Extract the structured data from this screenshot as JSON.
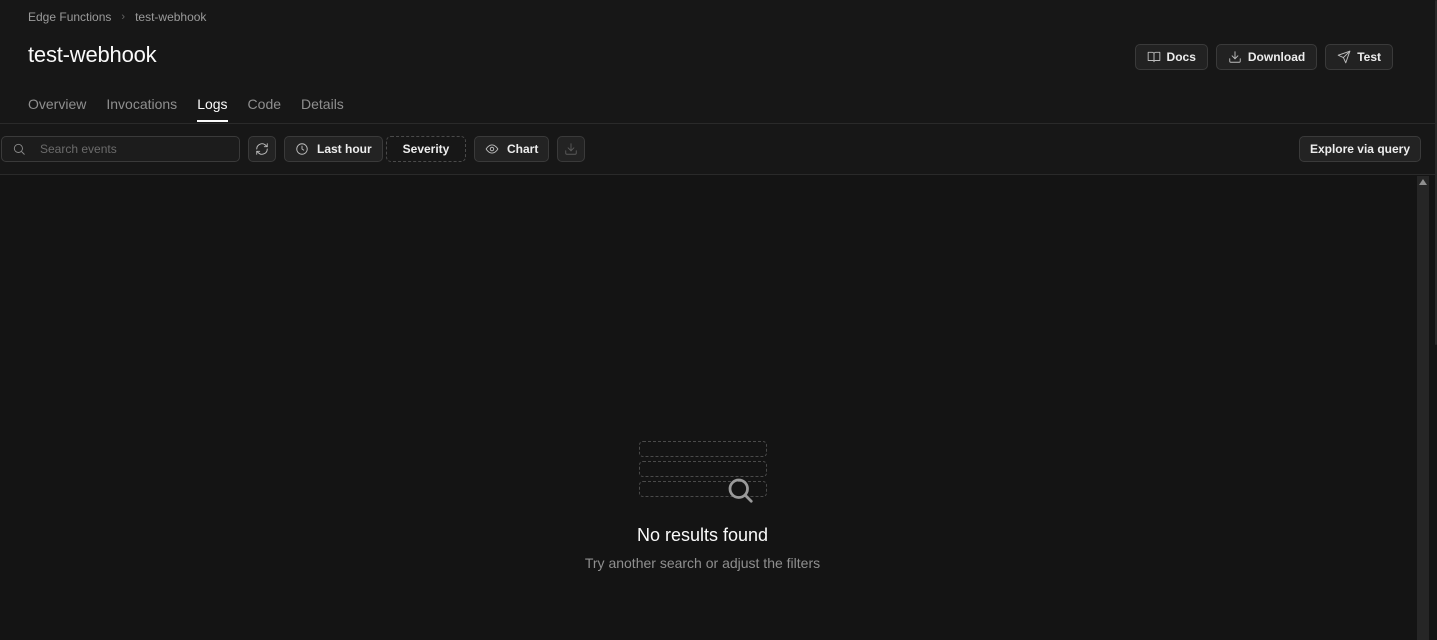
{
  "breadcrumb": {
    "parent": "Edge Functions",
    "current": "test-webhook"
  },
  "page": {
    "title": "test-webhook"
  },
  "actions": {
    "docs": "Docs",
    "download": "Download",
    "test": "Test"
  },
  "tabs": [
    {
      "label": "Overview"
    },
    {
      "label": "Invocations"
    },
    {
      "label": "Logs",
      "active": true
    },
    {
      "label": "Code"
    },
    {
      "label": "Details"
    }
  ],
  "toolbar": {
    "search_placeholder": "Search events",
    "time_range": "Last hour",
    "severity": "Severity",
    "chart": "Chart",
    "explore": "Explore via query"
  },
  "empty_state": {
    "title": "No results found",
    "subtitle": "Try another search or adjust the filters"
  },
  "icons": [
    "book-icon",
    "download-icon",
    "send-icon",
    "search-icon",
    "refresh-icon",
    "clock-icon",
    "eye-icon"
  ]
}
